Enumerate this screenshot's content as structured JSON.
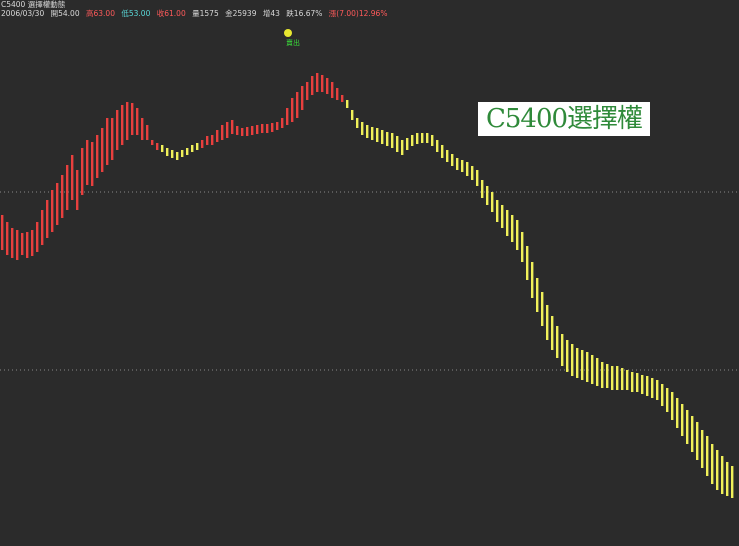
{
  "header": {
    "title": "C5400 選擇權動態",
    "date": "2006/03/30",
    "open": "開54.00",
    "high": "高63.00",
    "low": "低53.00",
    "close": "收61.00",
    "volume": "量1575",
    "amount": "金25939",
    "change_count": "增43",
    "change_pct": "跌16.67%",
    "updown": "漲(7.00)12.96%"
  },
  "watermark": "C5400選擇權",
  "signal_label": "賣出",
  "colors": {
    "background": "#2b2b2b",
    "bar_up": "#e8403e",
    "bar_down": "#f0f05a",
    "grid": "#8a8a8a",
    "signal": "#e8e830",
    "signal_text": "#3ad83a"
  },
  "chart_data": {
    "type": "bar",
    "style": "range bars (high-low), colored by trend",
    "series": [
      {
        "name": "up",
        "color": "#e8403e",
        "bars": [
          [
            0,
            215,
            250
          ],
          [
            5,
            222,
            255
          ],
          [
            10,
            228,
            258
          ],
          [
            15,
            230,
            260
          ],
          [
            20,
            233,
            255
          ],
          [
            25,
            232,
            258
          ],
          [
            30,
            230,
            256
          ],
          [
            35,
            222,
            252
          ],
          [
            40,
            210,
            245
          ],
          [
            45,
            200,
            238
          ],
          [
            50,
            190,
            232
          ],
          [
            55,
            183,
            225
          ],
          [
            60,
            175,
            218
          ],
          [
            65,
            165,
            210
          ],
          [
            70,
            155,
            200
          ],
          [
            75,
            170,
            210
          ],
          [
            80,
            148,
            195
          ],
          [
            85,
            140,
            185
          ],
          [
            90,
            142,
            186
          ],
          [
            95,
            135,
            178
          ],
          [
            100,
            128,
            172
          ],
          [
            105,
            118,
            165
          ],
          [
            110,
            118,
            160
          ],
          [
            115,
            110,
            150
          ],
          [
            120,
            105,
            145
          ],
          [
            125,
            102,
            140
          ],
          [
            130,
            103,
            135
          ],
          [
            135,
            108,
            135
          ],
          [
            140,
            118,
            140
          ],
          [
            145,
            125,
            140
          ],
          [
            150,
            140,
            145
          ],
          [
            155,
            143,
            150
          ],
          [
            200,
            140,
            148
          ],
          [
            205,
            136,
            145
          ],
          [
            210,
            135,
            145
          ],
          [
            215,
            130,
            142
          ],
          [
            220,
            125,
            140
          ],
          [
            225,
            122,
            138
          ],
          [
            230,
            120,
            134
          ],
          [
            235,
            126,
            135
          ],
          [
            240,
            128,
            136
          ],
          [
            245,
            127,
            136
          ],
          [
            250,
            126,
            135
          ],
          [
            255,
            125,
            134
          ],
          [
            260,
            124,
            133
          ],
          [
            265,
            124,
            133
          ],
          [
            270,
            123,
            132
          ],
          [
            275,
            122,
            130
          ],
          [
            280,
            118,
            128
          ],
          [
            285,
            108,
            125
          ],
          [
            290,
            98,
            122
          ],
          [
            295,
            92,
            118
          ],
          [
            300,
            86,
            110
          ],
          [
            305,
            82,
            100
          ],
          [
            310,
            76,
            95
          ],
          [
            315,
            73,
            92
          ],
          [
            320,
            75,
            92
          ],
          [
            325,
            78,
            94
          ],
          [
            330,
            82,
            98
          ],
          [
            335,
            88,
            100
          ],
          [
            340,
            95,
            102
          ]
        ]
      },
      {
        "name": "down",
        "color": "#f0f05a",
        "bars": [
          [
            160,
            145,
            152
          ],
          [
            165,
            148,
            156
          ],
          [
            170,
            150,
            158
          ],
          [
            175,
            152,
            160
          ],
          [
            180,
            150,
            157
          ],
          [
            185,
            148,
            155
          ],
          [
            190,
            145,
            152
          ],
          [
            195,
            143,
            150
          ],
          [
            345,
            100,
            108
          ],
          [
            350,
            110,
            120
          ],
          [
            355,
            118,
            128
          ],
          [
            360,
            122,
            135
          ],
          [
            365,
            125,
            138
          ],
          [
            370,
            127,
            140
          ],
          [
            375,
            128,
            142
          ],
          [
            380,
            130,
            144
          ],
          [
            385,
            132,
            146
          ],
          [
            390,
            133,
            148
          ],
          [
            395,
            136,
            152
          ],
          [
            400,
            140,
            155
          ],
          [
            405,
            138,
            150
          ],
          [
            410,
            135,
            146
          ],
          [
            415,
            133,
            144
          ],
          [
            420,
            133,
            143
          ],
          [
            425,
            133,
            143
          ],
          [
            430,
            135,
            146
          ],
          [
            435,
            140,
            152
          ],
          [
            440,
            145,
            158
          ],
          [
            445,
            150,
            162
          ],
          [
            450,
            154,
            166
          ],
          [
            455,
            158,
            170
          ],
          [
            460,
            160,
            172
          ],
          [
            465,
            162,
            176
          ],
          [
            470,
            166,
            180
          ],
          [
            475,
            170,
            186
          ],
          [
            480,
            180,
            198
          ],
          [
            485,
            186,
            205
          ],
          [
            490,
            192,
            212
          ],
          [
            495,
            200,
            222
          ],
          [
            500,
            205,
            228
          ],
          [
            505,
            210,
            236
          ],
          [
            510,
            215,
            242
          ],
          [
            515,
            220,
            250
          ],
          [
            520,
            232,
            262
          ],
          [
            525,
            246,
            280
          ],
          [
            530,
            262,
            298
          ],
          [
            535,
            278,
            312
          ],
          [
            540,
            292,
            326
          ],
          [
            545,
            305,
            340
          ],
          [
            550,
            316,
            350
          ],
          [
            555,
            326,
            358
          ],
          [
            560,
            334,
            366
          ],
          [
            565,
            340,
            372
          ],
          [
            570,
            344,
            376
          ],
          [
            575,
            348,
            378
          ],
          [
            580,
            350,
            380
          ],
          [
            585,
            352,
            382
          ],
          [
            590,
            355,
            384
          ],
          [
            595,
            358,
            386
          ],
          [
            600,
            362,
            388
          ],
          [
            605,
            364,
            388
          ],
          [
            610,
            366,
            390
          ],
          [
            615,
            366,
            390
          ],
          [
            620,
            368,
            390
          ],
          [
            625,
            370,
            390
          ],
          [
            630,
            372,
            392
          ],
          [
            635,
            373,
            392
          ],
          [
            640,
            375,
            394
          ],
          [
            645,
            376,
            396
          ],
          [
            650,
            378,
            398
          ],
          [
            655,
            380,
            400
          ],
          [
            660,
            384,
            406
          ],
          [
            665,
            388,
            412
          ],
          [
            670,
            392,
            420
          ],
          [
            675,
            398,
            428
          ],
          [
            680,
            404,
            436
          ],
          [
            685,
            410,
            444
          ],
          [
            690,
            416,
            452
          ],
          [
            695,
            422,
            460
          ],
          [
            700,
            430,
            468
          ],
          [
            705,
            436,
            476
          ],
          [
            710,
            444,
            484
          ],
          [
            715,
            450,
            490
          ],
          [
            720,
            456,
            494
          ],
          [
            725,
            462,
            496
          ],
          [
            730,
            466,
            498
          ]
        ]
      }
    ],
    "grid_lines_y": [
      192,
      370
    ],
    "ylim": [
      0,
      542
    ],
    "grid": true,
    "signal": {
      "index": 288,
      "y": 33,
      "label": "賣出"
    }
  }
}
